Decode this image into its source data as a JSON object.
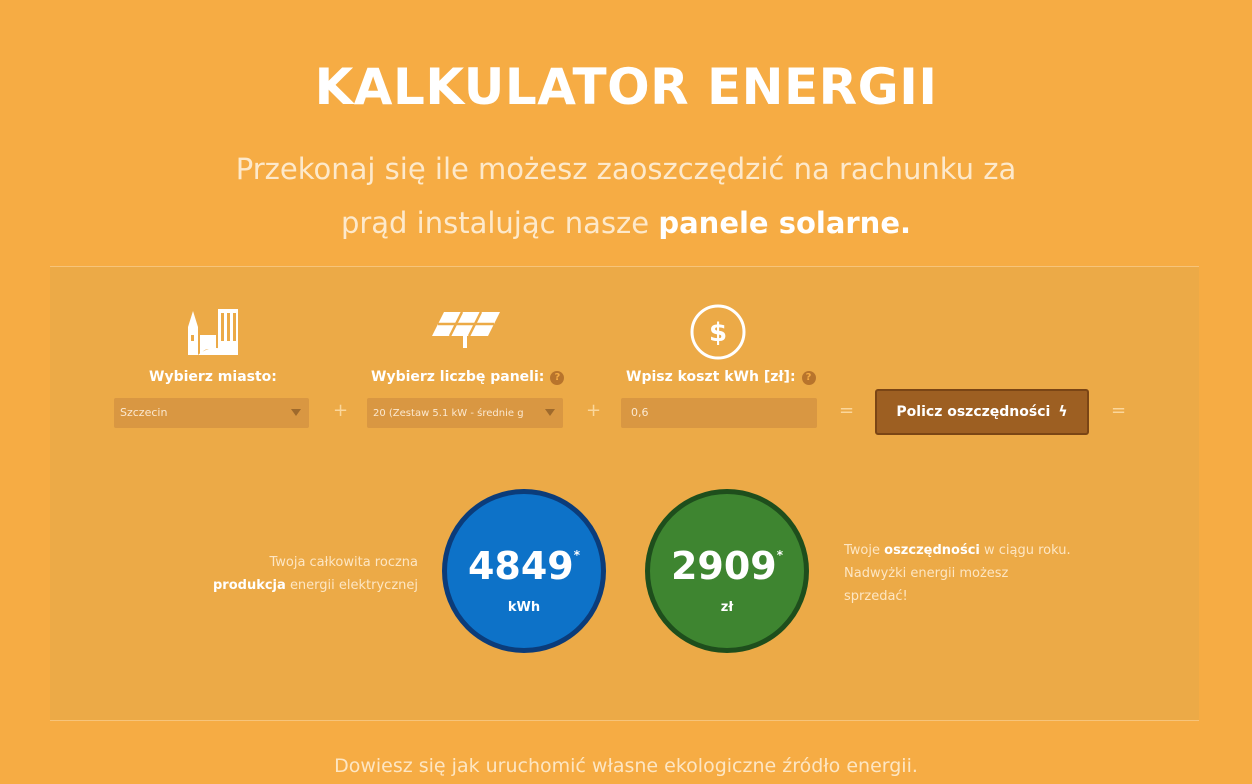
{
  "header": {
    "title": "KALKULATOR ENERGII",
    "subtitle_line1": "Przekonaj się ile możesz zaoszczędzić na rachunku za",
    "subtitle_line2_plain": "prąd instalując nasze",
    "subtitle_line2_bold": "panele solarne."
  },
  "form": {
    "city": {
      "icon": "city-icon",
      "label": "Wybierz miasto:",
      "value": "Szczecin"
    },
    "panels": {
      "icon": "solar-panel-icon",
      "label": "Wybierz liczbę paneli:",
      "help": "?",
      "value": "20 (Zestaw 5.1 kW - średnie g"
    },
    "cost": {
      "icon": "dollar-icon",
      "label": "Wpisz koszt kWh [zł]:",
      "help": "?",
      "value": "0,6"
    },
    "ops": {
      "plus1": "+",
      "plus2": "+",
      "equals1": "=",
      "equals2": "="
    },
    "calculate_label": "Policz oszczędności",
    "bolt": "ϟ"
  },
  "results": {
    "production": {
      "value": "4849",
      "mark": "*",
      "unit": "kWh",
      "color": "#0d72c8",
      "desc_plain1": "Twoja całkowita roczna",
      "desc_bold": "produkcja",
      "desc_plain2": "energii elektrycznej"
    },
    "savings": {
      "value": "2909",
      "mark": "*",
      "unit": "zł",
      "color": "#3e8530",
      "desc_plain1": "Twoje",
      "desc_bold": "oszczędności",
      "desc_plain2": "w ciągu roku. Nadwyżki energii możesz sprzedać!"
    }
  },
  "footer": {
    "text": "Dowiesz się jak uruchomić własne ekologiczne źródło energii."
  },
  "colors": {
    "background": "#f6ac44",
    "panel": "#ecaa47",
    "button": "#9d5f22"
  }
}
